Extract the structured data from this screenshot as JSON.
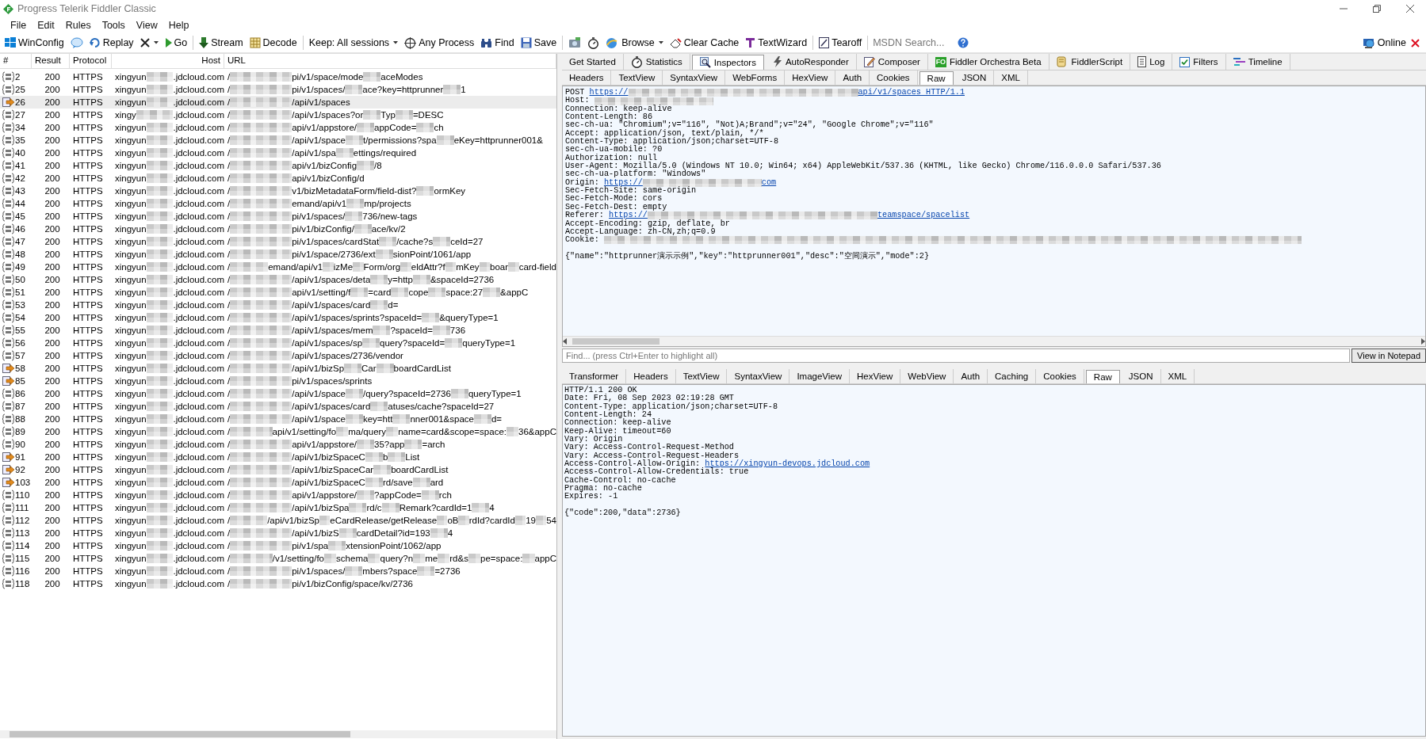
{
  "window": {
    "title": "Progress Telerik Fiddler Classic"
  },
  "menu": [
    "File",
    "Edit",
    "Rules",
    "Tools",
    "View",
    "Help"
  ],
  "toolbar": {
    "items": [
      {
        "kind": "button",
        "label": "WinConfig"
      },
      {
        "kind": "icon"
      },
      {
        "kind": "button",
        "label": "Replay"
      },
      {
        "kind": "dropdown"
      },
      {
        "kind": "button",
        "label": "Go"
      },
      {
        "kind": "sep"
      },
      {
        "kind": "button",
        "label": "Stream"
      },
      {
        "kind": "button",
        "label": "Decode"
      },
      {
        "kind": "sep"
      },
      {
        "kind": "dropdown",
        "label": "Keep: All sessions"
      },
      {
        "kind": "button",
        "label": "Any Process"
      },
      {
        "kind": "button",
        "label": "Find"
      },
      {
        "kind": "button",
        "label": "Save"
      },
      {
        "kind": "sep"
      },
      {
        "kind": "icon"
      },
      {
        "kind": "icon"
      },
      {
        "kind": "dropdown",
        "label": "Browse"
      },
      {
        "kind": "button",
        "label": "Clear Cache"
      },
      {
        "kind": "button",
        "label": "TextWizard"
      },
      {
        "kind": "sep"
      },
      {
        "kind": "button",
        "label": "Tearoff"
      },
      {
        "kind": "sep"
      },
      {
        "kind": "search",
        "placeholder": "MSDN Search..."
      },
      {
        "kind": "icon"
      }
    ],
    "online": "Online"
  },
  "sessions": {
    "columns": [
      "#",
      "Result",
      "Protocol",
      "Host",
      "URL"
    ],
    "rows": [
      {
        "number": "2",
        "kind": "json",
        "selected": false,
        "result": "200",
        "protocol": "HTTPS",
        "host": [
          "xingyun",
          ".jdcloud.com"
        ],
        "url": [
          "/",
          "pi/v1/space/mode",
          "aceModes"
        ]
      },
      {
        "number": "25",
        "kind": "json",
        "selected": false,
        "result": "200",
        "protocol": "HTTPS",
        "host": [
          "xingyun",
          ".jdcloud.com"
        ],
        "url": [
          "/",
          "pi/v1/spaces/",
          "ace?key=httprunner",
          "1"
        ]
      },
      {
        "number": "26",
        "kind": "request",
        "selected": true,
        "result": "200",
        "protocol": "HTTPS",
        "host": [
          "xingyun",
          ".jdcloud.com"
        ],
        "url": [
          "/",
          "/api/v1/spaces"
        ]
      },
      {
        "number": "27",
        "kind": "json",
        "selected": false,
        "result": "200",
        "protocol": "HTTPS",
        "host": [
          "xingy",
          ".jdcloud.com"
        ],
        "url": [
          "/",
          "/api/v1/spaces?or",
          "Typ",
          "=DESC"
        ]
      },
      {
        "number": "34",
        "kind": "json",
        "selected": false,
        "result": "200",
        "protocol": "HTTPS",
        "host": [
          "xingyun",
          ".jdcloud.com"
        ],
        "url": [
          "/",
          "api/v1/appstore/",
          "appCode=",
          "ch"
        ]
      },
      {
        "number": "35",
        "kind": "json",
        "selected": false,
        "result": "200",
        "protocol": "HTTPS",
        "host": [
          "xingyun",
          ".jdcloud.com"
        ],
        "url": [
          "/",
          "/api/v1/space",
          "t/permissions?spa",
          "eKey=httprunner001&"
        ]
      },
      {
        "number": "40",
        "kind": "json",
        "selected": false,
        "result": "200",
        "protocol": "HTTPS",
        "host": [
          "xingyun",
          ".jdcloud.com"
        ],
        "url": [
          "/",
          "/api/v1/spa",
          "ettings/required"
        ]
      },
      {
        "number": "41",
        "kind": "json",
        "selected": false,
        "result": "200",
        "protocol": "HTTPS",
        "host": [
          "xingyun",
          ".jdcloud.com"
        ],
        "url": [
          "/",
          "api/v1/bizConfig",
          "/8"
        ]
      },
      {
        "number": "42",
        "kind": "json",
        "selected": false,
        "result": "200",
        "protocol": "HTTPS",
        "host": [
          "xingyun",
          ".jdcloud.com"
        ],
        "url": [
          "/",
          "api/v1/bizConfig/d"
        ]
      },
      {
        "number": "43",
        "kind": "json",
        "selected": false,
        "result": "200",
        "protocol": "HTTPS",
        "host": [
          "xingyun",
          ".jdcloud.com"
        ],
        "url": [
          "/",
          "v1/bizMetadataForm/field-dist?",
          "ormKey"
        ]
      },
      {
        "number": "44",
        "kind": "json",
        "selected": false,
        "result": "200",
        "protocol": "HTTPS",
        "host": [
          "xingyun",
          ".jdcloud.com"
        ],
        "url": [
          "/",
          "emand/api/v1",
          "mp/projects"
        ]
      },
      {
        "number": "45",
        "kind": "json",
        "selected": false,
        "result": "200",
        "protocol": "HTTPS",
        "host": [
          "xingyun",
          ".jdcloud.com"
        ],
        "url": [
          "/",
          "pi/v1/spaces/",
          "736/new-tags"
        ]
      },
      {
        "number": "46",
        "kind": "json",
        "selected": false,
        "result": "200",
        "protocol": "HTTPS",
        "host": [
          "xingyun",
          ".jdcloud.com"
        ],
        "url": [
          "/",
          "pi/v1/bizConfig/",
          "ace/kv/2"
        ]
      },
      {
        "number": "47",
        "kind": "json",
        "selected": false,
        "result": "200",
        "protocol": "HTTPS",
        "host": [
          "xingyun",
          ".jdcloud.com"
        ],
        "url": [
          "/",
          "pi/v1/spaces/cardStat",
          "/cache?s",
          "ceId=27"
        ]
      },
      {
        "number": "48",
        "kind": "json",
        "selected": false,
        "result": "200",
        "protocol": "HTTPS",
        "host": [
          "xingyun",
          ".jdcloud.com"
        ],
        "url": [
          "/",
          "pi/v1/space/2736/ext",
          "sionPoint/1061/app"
        ]
      },
      {
        "number": "49",
        "kind": "json",
        "selected": false,
        "result": "200",
        "protocol": "HTTPS",
        "host": [
          "xingyun",
          ".jdcloud.com"
        ],
        "url": [
          "/",
          "emand/api/v1",
          "izMe",
          "Form/org",
          "eldAttr?f",
          "mKey",
          "boar",
          "card-field"
        ]
      },
      {
        "number": "50",
        "kind": "json",
        "selected": false,
        "result": "200",
        "protocol": "HTTPS",
        "host": [
          "xingyun",
          ".jdcloud.com"
        ],
        "url": [
          "/",
          "/api/v1/spaces/deta",
          "y=http",
          "&spaceId=2736"
        ]
      },
      {
        "number": "51",
        "kind": "json",
        "selected": false,
        "result": "200",
        "protocol": "HTTPS",
        "host": [
          "xingyun",
          ".jdcloud.com"
        ],
        "url": [
          "/",
          "api/v1/setting/f",
          "=card",
          "cope",
          "space:27",
          "&appC"
        ]
      },
      {
        "number": "53",
        "kind": "json",
        "selected": false,
        "result": "200",
        "protocol": "HTTPS",
        "host": [
          "xingyun",
          ".jdcloud.com"
        ],
        "url": [
          "/",
          "/api/v1/spaces/card",
          "d="
        ]
      },
      {
        "number": "54",
        "kind": "json",
        "selected": false,
        "result": "200",
        "protocol": "HTTPS",
        "host": [
          "xingyun",
          ".jdcloud.com"
        ],
        "url": [
          "/",
          "/api/v1/spaces/sprints?spaceId=",
          "&queryType=1"
        ]
      },
      {
        "number": "55",
        "kind": "json",
        "selected": false,
        "result": "200",
        "protocol": "HTTPS",
        "host": [
          "xingyun",
          ".jdcloud.com"
        ],
        "url": [
          "/",
          "/api/v1/spaces/mem",
          "?spaceId=",
          "736"
        ]
      },
      {
        "number": "56",
        "kind": "json",
        "selected": false,
        "result": "200",
        "protocol": "HTTPS",
        "host": [
          "xingyun",
          ".jdcloud.com"
        ],
        "url": [
          "/",
          "/api/v1/spaces/sp",
          "query?spaceId=",
          "queryType=1"
        ]
      },
      {
        "number": "57",
        "kind": "json",
        "selected": false,
        "result": "200",
        "protocol": "HTTPS",
        "host": [
          "xingyun",
          ".jdcloud.com"
        ],
        "url": [
          "/",
          "/api/v1/spaces/2736/vendor"
        ]
      },
      {
        "number": "58",
        "kind": "request",
        "selected": false,
        "result": "200",
        "protocol": "HTTPS",
        "host": [
          "xingyun",
          ".jdcloud.com"
        ],
        "url": [
          "/",
          "/api/v1/bizSp",
          "Car",
          "boardCardList"
        ]
      },
      {
        "number": "85",
        "kind": "request",
        "selected": false,
        "result": "200",
        "protocol": "HTTPS",
        "host": [
          "xingyun",
          ".jdcloud.com"
        ],
        "url": [
          "/",
          "pi/v1/spaces/sprints"
        ]
      },
      {
        "number": "86",
        "kind": "json",
        "selected": false,
        "result": "200",
        "protocol": "HTTPS",
        "host": [
          "xingyun",
          ".jdcloud.com"
        ],
        "url": [
          "/",
          "/api/v1/space",
          "/query?spaceId=2736",
          "queryType=1"
        ]
      },
      {
        "number": "87",
        "kind": "json",
        "selected": false,
        "result": "200",
        "protocol": "HTTPS",
        "host": [
          "xingyun",
          ".jdcloud.com"
        ],
        "url": [
          "/",
          "/api/v1/spaces/card",
          "atuses/cache?spaceId=27"
        ]
      },
      {
        "number": "88",
        "kind": "json",
        "selected": false,
        "result": "200",
        "protocol": "HTTPS",
        "host": [
          "xingyun",
          ".jdcloud.com"
        ],
        "url": [
          "/",
          "/api/v1/space",
          "key=htt",
          "nner001&space",
          "d="
        ]
      },
      {
        "number": "89",
        "kind": "json",
        "selected": false,
        "result": "200",
        "protocol": "HTTPS",
        "host": [
          "xingyun",
          ".jdcloud.com"
        ],
        "url": [
          "/",
          "api/v1/setting/fo",
          "ma/query",
          "name=card&scope=space:",
          "36&appC"
        ]
      },
      {
        "number": "90",
        "kind": "json",
        "selected": false,
        "result": "200",
        "protocol": "HTTPS",
        "host": [
          "xingyun",
          ".jdcloud.com"
        ],
        "url": [
          "/",
          "api/v1/appstore/",
          "35?app",
          "=arch"
        ]
      },
      {
        "number": "91",
        "kind": "request",
        "selected": false,
        "result": "200",
        "protocol": "HTTPS",
        "host": [
          "xingyun",
          ".jdcloud.com"
        ],
        "url": [
          "/",
          "/api/v1/bizSpaceC",
          "b",
          "List"
        ]
      },
      {
        "number": "92",
        "kind": "request",
        "selected": false,
        "result": "200",
        "protocol": "HTTPS",
        "host": [
          "xingyun",
          ".jdcloud.com"
        ],
        "url": [
          "/",
          "/api/v1/bizSpaceCar",
          "boardCardList"
        ]
      },
      {
        "number": "103",
        "kind": "request",
        "selected": false,
        "result": "200",
        "protocol": "HTTPS",
        "host": [
          "xingyun",
          ".jdcloud.com"
        ],
        "url": [
          "/",
          "/api/v1/bizSpaceC",
          "rd/save",
          "ard"
        ]
      },
      {
        "number": "110",
        "kind": "json",
        "selected": false,
        "result": "200",
        "protocol": "HTTPS",
        "host": [
          "xingyun",
          ".jdcloud.com"
        ],
        "url": [
          "/",
          "api/v1/appstore/",
          "?appCode=",
          "rch"
        ]
      },
      {
        "number": "111",
        "kind": "json",
        "selected": false,
        "result": "200",
        "protocol": "HTTPS",
        "host": [
          "xingyun",
          ".jdcloud.com"
        ],
        "url": [
          "/",
          "/api/v1/bizSpa",
          "rd/c",
          "Remark?cardId=1",
          "4"
        ]
      },
      {
        "number": "112",
        "kind": "json",
        "selected": false,
        "result": "200",
        "protocol": "HTTPS",
        "host": [
          "xingyun",
          ".jdcloud.com"
        ],
        "url": [
          "/",
          "/api/v1/bizSp",
          "eCardRelease/getRelease",
          "oB",
          "rdId?cardId",
          "19",
          "54"
        ]
      },
      {
        "number": "113",
        "kind": "json",
        "selected": false,
        "result": "200",
        "protocol": "HTTPS",
        "host": [
          "xingyun",
          ".jdcloud.com"
        ],
        "url": [
          "/",
          "/api/v1/bizS",
          "cardDetail?id=193",
          "4"
        ]
      },
      {
        "number": "114",
        "kind": "json",
        "selected": false,
        "result": "200",
        "protocol": "HTTPS",
        "host": [
          "xingyun",
          ".jdcloud.com"
        ],
        "url": [
          "/",
          "pi/v1/spa",
          "xtensionPoint/1062/app"
        ]
      },
      {
        "number": "115",
        "kind": "json",
        "selected": false,
        "result": "200",
        "protocol": "HTTPS",
        "host": [
          "xingyun",
          ".jdcloud.com"
        ],
        "url": [
          "/",
          "/v1/setting/fo",
          "schema",
          "query?n",
          "me",
          "rd&s",
          "pe=space:",
          "appC"
        ]
      },
      {
        "number": "116",
        "kind": "json",
        "selected": false,
        "result": "200",
        "protocol": "HTTPS",
        "host": [
          "xingyun",
          ".jdcloud.com"
        ],
        "url": [
          "/",
          "pi/v1/spaces/",
          "mbers?space",
          "=2736"
        ]
      },
      {
        "number": "118",
        "kind": "json",
        "selected": false,
        "result": "200",
        "protocol": "HTTPS",
        "host": [
          "xingyun",
          ".jdcloud.com"
        ],
        "url": [
          "/",
          "pi/v1/bizConfig/space/kv/2736"
        ]
      }
    ]
  },
  "main_tabs": [
    {
      "label": "Get Started",
      "selected": false
    },
    {
      "label": "Statistics",
      "selected": false
    },
    {
      "label": "Inspectors",
      "selected": true
    },
    {
      "label": "AutoResponder",
      "selected": false
    },
    {
      "label": "Composer",
      "selected": false
    },
    {
      "label": "Fiddler Orchestra Beta",
      "badge": "FO",
      "selected": false
    },
    {
      "label": "FiddlerScript",
      "selected": false
    },
    {
      "label": "Log",
      "selected": false
    },
    {
      "label": "Filters",
      "selected": false
    },
    {
      "label": "Timeline",
      "selected": false
    }
  ],
  "request": {
    "tabs": [
      {
        "label": "Headers",
        "selected": false
      },
      {
        "label": "TextView",
        "selected": false
      },
      {
        "label": "SyntaxView",
        "selected": false
      },
      {
        "label": "WebForms",
        "selected": false
      },
      {
        "label": "HexView",
        "selected": false
      },
      {
        "label": "Auth",
        "selected": false
      },
      {
        "label": "Cookies",
        "selected": false
      },
      {
        "label": "Raw",
        "selected": true
      },
      {
        "label": "JSON",
        "selected": false
      },
      {
        "label": "XML",
        "selected": false
      }
    ],
    "lines": [
      [
        {
          "kind": "text",
          "text": "POST "
        },
        {
          "kind": "link",
          "text": "https://"
        },
        {
          "kind": "blur"
        },
        {
          "kind": "link",
          "text": "api/v1/spaces HTTP/1.1"
        }
      ],
      [
        {
          "kind": "text",
          "text": "Host: "
        },
        {
          "kind": "blur"
        }
      ],
      [
        {
          "kind": "text",
          "text": "Connection: keep-alive"
        }
      ],
      [
        {
          "kind": "text",
          "text": "Content-Length: 86"
        }
      ],
      [
        {
          "kind": "text",
          "text": "sec-ch-ua: \"Chromium\";v=\"116\", \"Not)A;Brand\";v=\"24\", \"Google Chrome\";v=\"116\""
        }
      ],
      [
        {
          "kind": "text",
          "text": "Accept: application/json, text/plain, */*"
        }
      ],
      [
        {
          "kind": "text",
          "text": "Content-Type: application/json;charset=UTF-8"
        }
      ],
      [
        {
          "kind": "text",
          "text": "sec-ch-ua-mobile: ?0"
        }
      ],
      [
        {
          "kind": "text",
          "text": "Authorization: null"
        }
      ],
      [
        {
          "kind": "text",
          "text": "User-Agent: Mozilla/5.0 (Windows NT 10.0; Win64; x64) AppleWebKit/537.36 (KHTML, like Gecko) Chrome/116.0.0.0 Safari/537.36"
        }
      ],
      [
        {
          "kind": "text",
          "text": "sec-ch-ua-platform: \"Windows\""
        }
      ],
      [
        {
          "kind": "text",
          "text": "Origin: "
        },
        {
          "kind": "link",
          "text": "https://"
        },
        {
          "kind": "blur"
        },
        {
          "kind": "link",
          "text": "com"
        }
      ],
      [
        {
          "kind": "text",
          "text": "Sec-Fetch-Site: same-origin"
        }
      ],
      [
        {
          "kind": "text",
          "text": "Sec-Fetch-Mode: cors"
        }
      ],
      [
        {
          "kind": "text",
          "text": "Sec-Fetch-Dest: empty"
        }
      ],
      [
        {
          "kind": "text",
          "text": "Referer: "
        },
        {
          "kind": "link",
          "text": "https://"
        },
        {
          "kind": "blur"
        },
        {
          "kind": "link",
          "text": "teamspace/spacelist"
        }
      ],
      [
        {
          "kind": "text",
          "text": "Accept-Encoding: gzip, deflate, br"
        }
      ],
      [
        {
          "kind": "text",
          "text": "Accept-Language: zh-CN,zh;q=0.9"
        }
      ],
      [
        {
          "kind": "text",
          "text": "Cookie: "
        },
        {
          "kind": "blur"
        }
      ]
    ],
    "body": "{\"name\":\"httprunner演示示例\",\"key\":\"httprunner001\",\"desc\":\"空间演示\",\"mode\":2}",
    "find": {
      "placeholder": "Find... (press Ctrl+Enter to highlight all)",
      "button": "View in Notepad"
    }
  },
  "response": {
    "tabs": [
      {
        "label": "Transformer",
        "selected": false
      },
      {
        "label": "Headers",
        "selected": false
      },
      {
        "label": "TextView",
        "selected": false
      },
      {
        "label": "SyntaxView",
        "selected": false
      },
      {
        "label": "ImageView",
        "selected": false
      },
      {
        "label": "HexView",
        "selected": false
      },
      {
        "label": "WebView",
        "selected": false
      },
      {
        "label": "Auth",
        "selected": false
      },
      {
        "label": "Caching",
        "selected": false
      },
      {
        "label": "Cookies",
        "selected": false
      },
      {
        "label": "Raw",
        "selected": true
      },
      {
        "label": "JSON",
        "selected": false
      },
      {
        "label": "XML",
        "selected": false
      }
    ],
    "lines": [
      [
        {
          "kind": "text",
          "text": "HTTP/1.1 200 OK"
        }
      ],
      [
        {
          "kind": "text",
          "text": "Date: Fri, 08 Sep 2023 02:19:28 GMT"
        }
      ],
      [
        {
          "kind": "text",
          "text": "Content-Type: application/json;charset=UTF-8"
        }
      ],
      [
        {
          "kind": "text",
          "text": "Content-Length: 24"
        }
      ],
      [
        {
          "kind": "text",
          "text": "Connection: keep-alive"
        }
      ],
      [
        {
          "kind": "text",
          "text": "Keep-Alive: timeout=60"
        }
      ],
      [
        {
          "kind": "text",
          "text": "Vary: Origin"
        }
      ],
      [
        {
          "kind": "text",
          "text": "Vary: Access-Control-Request-Method"
        }
      ],
      [
        {
          "kind": "text",
          "text": "Vary: Access-Control-Request-Headers"
        }
      ],
      [
        {
          "kind": "text",
          "text": "Access-Control-Allow-Origin: "
        },
        {
          "kind": "link",
          "text": "https://xingyun-devops.jdcloud.com"
        }
      ],
      [
        {
          "kind": "text",
          "text": "Access-Control-Allow-Credentials: true"
        }
      ],
      [
        {
          "kind": "text",
          "text": "Cache-Control: no-cache"
        }
      ],
      [
        {
          "kind": "text",
          "text": "Pragma: no-cache"
        }
      ],
      [
        {
          "kind": "text",
          "text": "Expires: -1"
        }
      ]
    ],
    "body": "{\"code\":200,\"data\":2736}"
  }
}
